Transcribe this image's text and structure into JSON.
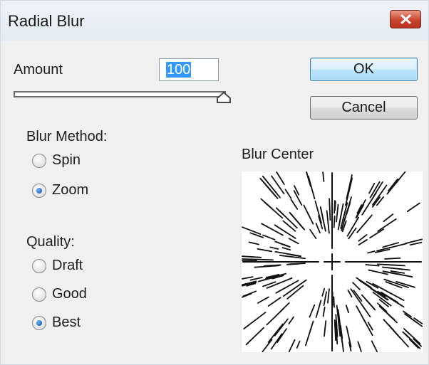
{
  "window": {
    "title": "Radial Blur",
    "close_icon": "close-icon"
  },
  "amount": {
    "label": "Amount",
    "value": "100",
    "slider_level": 1.0
  },
  "buttons": {
    "ok": "OK",
    "cancel": "Cancel"
  },
  "blur_method": {
    "label": "Blur Method:",
    "options": [
      {
        "label": "Spin",
        "selected": false
      },
      {
        "label": "Zoom",
        "selected": true
      }
    ]
  },
  "quality": {
    "label": "Quality:",
    "options": [
      {
        "label": "Draft",
        "selected": false
      },
      {
        "label": "Good",
        "selected": false
      },
      {
        "label": "Best",
        "selected": true
      }
    ]
  },
  "blur_center": {
    "label": "Blur Center"
  }
}
